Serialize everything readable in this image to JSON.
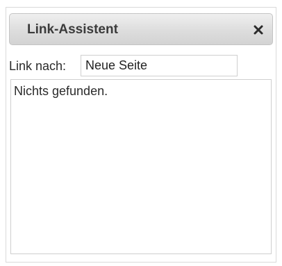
{
  "dialog": {
    "title": "Link-Assistent",
    "close_icon": "close-icon"
  },
  "link": {
    "label": "Link nach:",
    "value": "Neue Seite"
  },
  "results": {
    "message": "Nichts gefunden."
  }
}
